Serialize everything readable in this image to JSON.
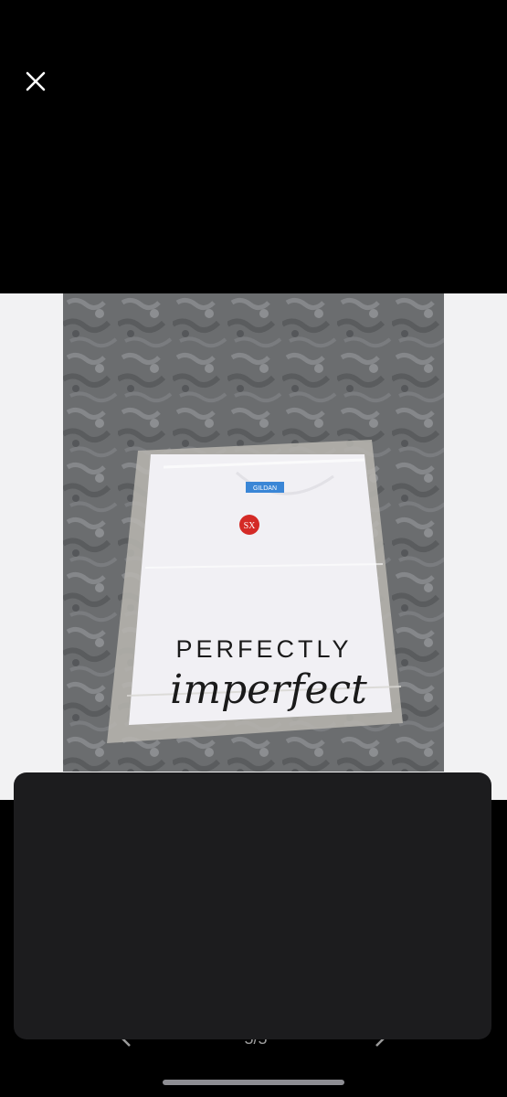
{
  "viewer": {
    "close_icon": "close-icon"
  },
  "photo": {
    "brand_tag": "GILDAN",
    "size_sticker": "SX",
    "print_line1": "PERFECTLY",
    "print_line2": "imperfect"
  },
  "navigation": {
    "prev_icon": "chevron-left-icon",
    "next_icon": "chevron-right-icon",
    "counter": "5/5"
  }
}
